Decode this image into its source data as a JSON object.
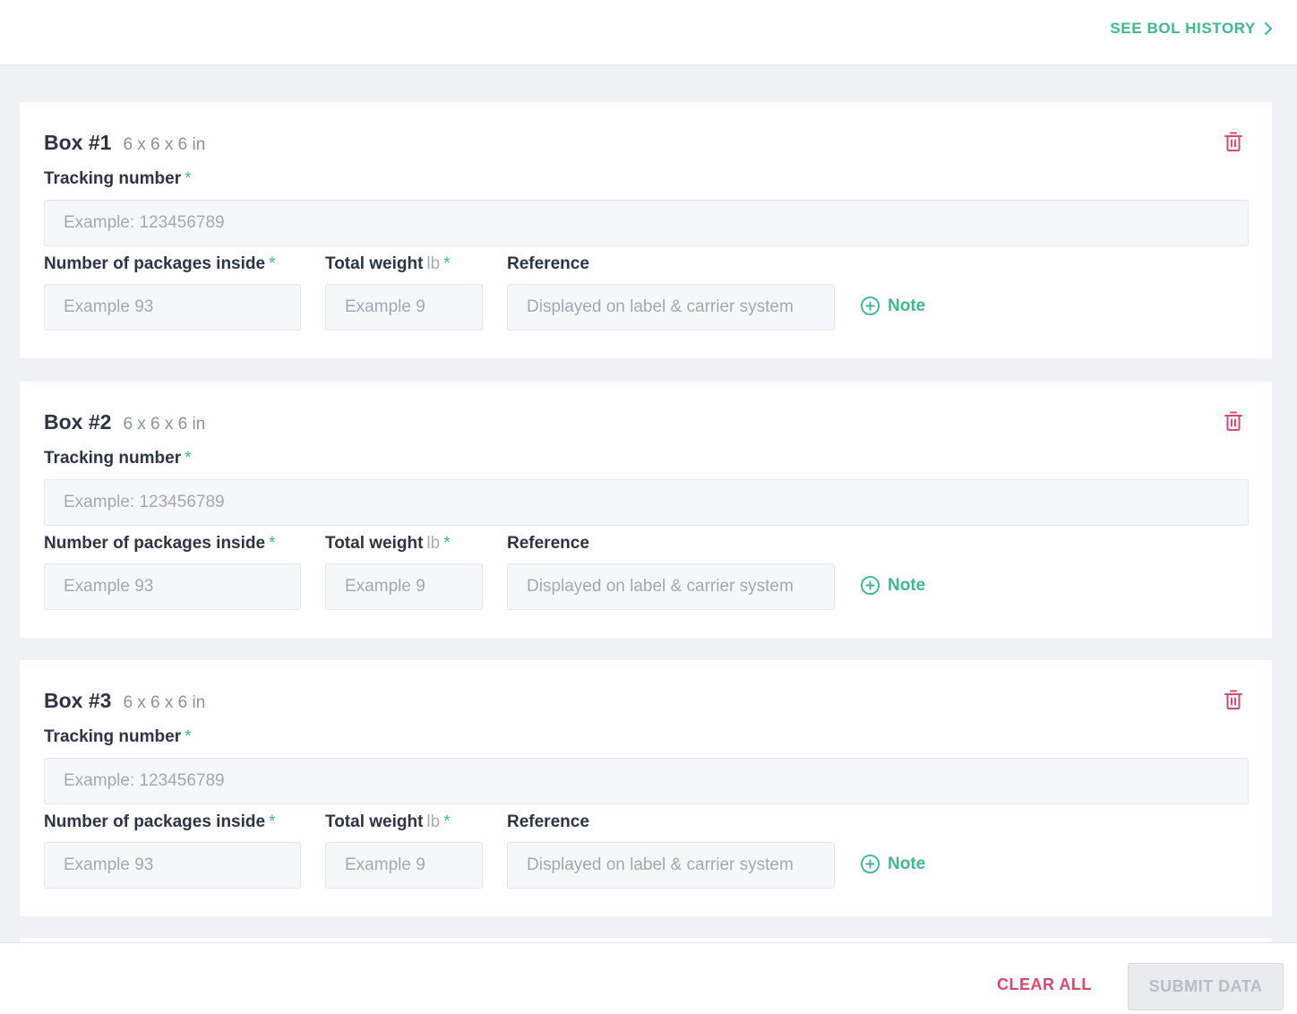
{
  "header": {
    "history_link_label": "SEE BOL HISTORY",
    "history_icon": "chevron-right-icon"
  },
  "boxes": [
    {
      "title": "Box #1",
      "dimensions": "6 x 6 x 6 in",
      "tracking_label": "Tracking number",
      "tracking_placeholder": "Example: 123456789",
      "tracking_value": "",
      "packages_label": "Number of packages inside",
      "packages_placeholder": "Example 93",
      "packages_value": "",
      "weight_label": "Total weight",
      "weight_unit": "lb",
      "weight_placeholder": "Example 9",
      "weight_value": "",
      "reference_label": "Reference",
      "reference_placeholder": "Displayed on label & carrier system",
      "reference_value": "",
      "note_label": "Note",
      "required_mark": "*"
    },
    {
      "title": "Box #2",
      "dimensions": "6 x 6 x 6 in",
      "tracking_label": "Tracking number",
      "tracking_placeholder": "Example: 123456789",
      "tracking_value": "",
      "packages_label": "Number of packages inside",
      "packages_placeholder": "Example 93",
      "packages_value": "",
      "weight_label": "Total weight",
      "weight_unit": "lb",
      "weight_placeholder": "Example 9",
      "weight_value": "",
      "reference_label": "Reference",
      "reference_placeholder": "Displayed on label & carrier system",
      "reference_value": "",
      "note_label": "Note",
      "required_mark": "*"
    },
    {
      "title": "Box #3",
      "dimensions": "6 x 6 x 6 in",
      "tracking_label": "Tracking number",
      "tracking_placeholder": "Example: 123456789",
      "tracking_value": "",
      "packages_label": "Number of packages inside",
      "packages_placeholder": "Example 93",
      "packages_value": "",
      "weight_label": "Total weight",
      "weight_unit": "lb",
      "weight_placeholder": "Example 9",
      "weight_value": "",
      "reference_label": "Reference",
      "reference_placeholder": "Displayed on label & carrier system",
      "reference_value": "",
      "note_label": "Note",
      "required_mark": "*"
    }
  ],
  "footer": {
    "clear_label": "CLEAR ALL",
    "submit_label": "SUBMIT DATA",
    "submit_enabled": false
  },
  "colors": {
    "accent": "#3cba8e",
    "danger": "#d84a6b",
    "text": "#2c3446",
    "muted": "#8a909c",
    "background": "#f0f1f4",
    "field_background": "#f6f7f9",
    "disabled": "#e9ebee"
  }
}
